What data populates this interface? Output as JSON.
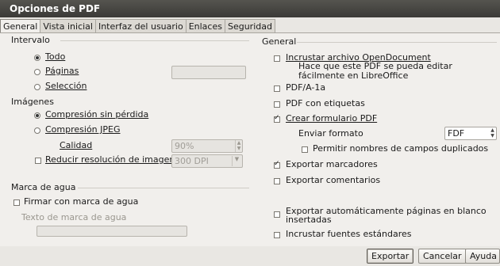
{
  "window": {
    "title": "Opciones de PDF"
  },
  "tabs": [
    {
      "label": "General",
      "active": true
    },
    {
      "label": "Vista inicial",
      "active": false
    },
    {
      "label": "Interfaz del usuario",
      "active": false
    },
    {
      "label": "Enlaces",
      "active": false
    },
    {
      "label": "Seguridad",
      "active": false
    }
  ],
  "left": {
    "range": {
      "heading": "Intervalo",
      "all_label": "Todo",
      "pages_label": "Páginas",
      "pages_value": "",
      "selection_label": "Selección",
      "selected": "all"
    },
    "images": {
      "heading": "Imágenes",
      "lossless_label": "Compresión sin pérdida",
      "jpeg_label": "Compresión JPEG",
      "quality_label": "Calidad",
      "quality_value": "90%",
      "reduce_label": "Reducir resolución de imagen",
      "reduce_checked": false,
      "resolution_value": "300 DPI",
      "selected": "lossless"
    },
    "watermark": {
      "heading": "Marca de agua",
      "sign_label": "Firmar con marca de agua",
      "sign_checked": false,
      "text_label": "Texto de marca de agua",
      "text_value": ""
    }
  },
  "right": {
    "heading": "General",
    "embed_od_label": "Incrustar archivo OpenDocument",
    "embed_od_desc": "Hace que este PDF se pueda editar fácilmente en LibreOffice",
    "embed_od_checked": false,
    "pdfa_label": "PDF/A-1a",
    "pdfa_checked": false,
    "tagged_label": "PDF con etiquetas",
    "tagged_checked": false,
    "form_label": "Crear formulario PDF",
    "form_checked": true,
    "submit_format_label": "Enviar formato",
    "submit_format_value": "FDF",
    "dup_names_label": "Permitir nombres de campos duplicados",
    "dup_names_checked": false,
    "bookmarks_label": "Exportar marcadores",
    "bookmarks_checked": true,
    "comments_label": "Exportar comentarios",
    "comments_checked": false,
    "blank_pages_label_1": "Exportar automáticamente páginas en blanco",
    "blank_pages_label_2": "insertadas",
    "blank_pages_checked": false,
    "std_fonts_label": "Incrustar fuentes estándares",
    "std_fonts_checked": false
  },
  "footer": {
    "export_label": "Exportar",
    "cancel_label": "Cancelar",
    "help_label": "Ayuda"
  }
}
